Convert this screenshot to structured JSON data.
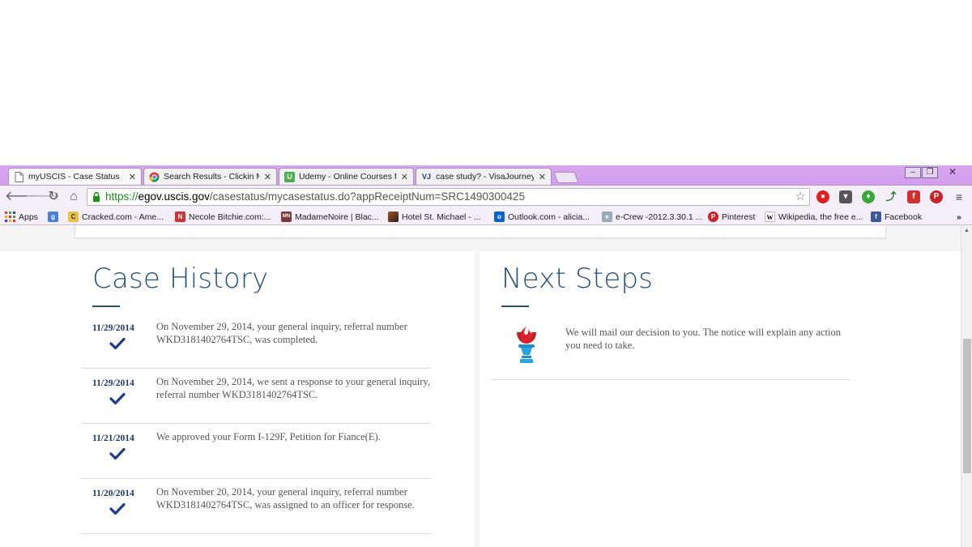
{
  "browser": {
    "tabs": [
      {
        "title": "myUSCIS - Case Status",
        "icon": "page-icon"
      },
      {
        "title": "Search Results - Clickin M",
        "icon": "chrome-icon"
      },
      {
        "title": "Udemy - Online Courses f",
        "icon": "udemy-icon"
      },
      {
        "title": "case study? - VisaJourney",
        "icon": "visajourney-icon"
      }
    ],
    "url_scheme": "https://",
    "url_host": "egov.uscis.gov",
    "url_path": "/casestatus/mycasestatus.do?appReceiptNum=SRC1490300425",
    "bookmarks": [
      {
        "label": "Apps",
        "icon": "apps-grid-icon"
      },
      {
        "label": "",
        "icon": "google-icon"
      },
      {
        "label": "Cracked.com - Ame...",
        "icon": "cracked-icon"
      },
      {
        "label": "Necole Bitchie.com:...",
        "icon": "necole-icon"
      },
      {
        "label": "MadameNoire | Blac...",
        "icon": "madamenoire-icon"
      },
      {
        "label": "Hotel St. Michael - ...",
        "icon": "hotel-icon"
      },
      {
        "label": "Outlook.com - alicia...",
        "icon": "outlook-icon"
      },
      {
        "label": "e-Crew -2012.3.30.1 ...",
        "icon": "ecrew-icon"
      },
      {
        "label": "Pinterest",
        "icon": "pinterest-icon"
      },
      {
        "label": "Wikipedia, the free e...",
        "icon": "wikipedia-icon"
      },
      {
        "label": "Facebook",
        "icon": "facebook-icon"
      }
    ],
    "overflow": "»"
  },
  "case_history": {
    "title": "Case History",
    "entries": [
      {
        "date": "11/29/2014",
        "text": "On November 29, 2014, your general inquiry, referral number WKD3181402764TSC, was completed."
      },
      {
        "date": "11/29/2014",
        "text": "On November 29, 2014, we sent a response to your general inquiry, referral number WKD3181402764TSC."
      },
      {
        "date": "11/21/2014",
        "text": "We approved your Form I-129F, Petition for Fiance(E)."
      },
      {
        "date": "11/20/2014",
        "text": "On November 20, 2014, your general inquiry, referral number WKD3181402764TSC, was assigned to an officer for response."
      }
    ]
  },
  "next_steps": {
    "title": "Next Steps",
    "text": "We will mail our decision to you. The notice will explain any action you need to take."
  },
  "colors": {
    "heading": "#24527a",
    "date": "#1e3a68",
    "check": "#1e3a8a",
    "chrome_theme": "#c98be8"
  }
}
